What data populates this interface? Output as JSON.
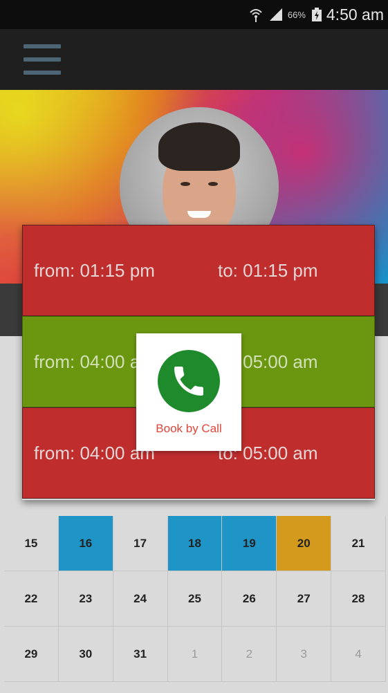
{
  "status_bar": {
    "battery_percent": "66%",
    "time": "4:50 am",
    "icons": [
      "wifi-icon",
      "signal-icon",
      "battery-icon"
    ]
  },
  "app_bar": {
    "menu_icon": "hamburger-menu-icon"
  },
  "profile": {
    "avatar": "profile-photo"
  },
  "slots": [
    {
      "from": "from: 01:15 pm",
      "to": "to: 01:15 pm",
      "color": "#bf2d2d"
    },
    {
      "from": "from: 04:00 am",
      "to": "to: 05:00 am",
      "color": "#6b9710"
    },
    {
      "from": "from: 04:00 am",
      "to": "to: 05:00 am",
      "color": "#bf2d2d"
    }
  ],
  "book_popup": {
    "label": "Book by Call",
    "icon": "phone-icon"
  },
  "calendar": {
    "rows": [
      [
        "15",
        "16",
        "17",
        "18",
        "19",
        "20",
        "21"
      ],
      [
        "22",
        "23",
        "24",
        "25",
        "26",
        "27",
        "28"
      ],
      [
        "29",
        "30",
        "31",
        "1",
        "2",
        "3",
        "4"
      ]
    ],
    "highlight_colors": {
      "blue": "#1e95c6",
      "gold": "#d49a1d"
    }
  }
}
